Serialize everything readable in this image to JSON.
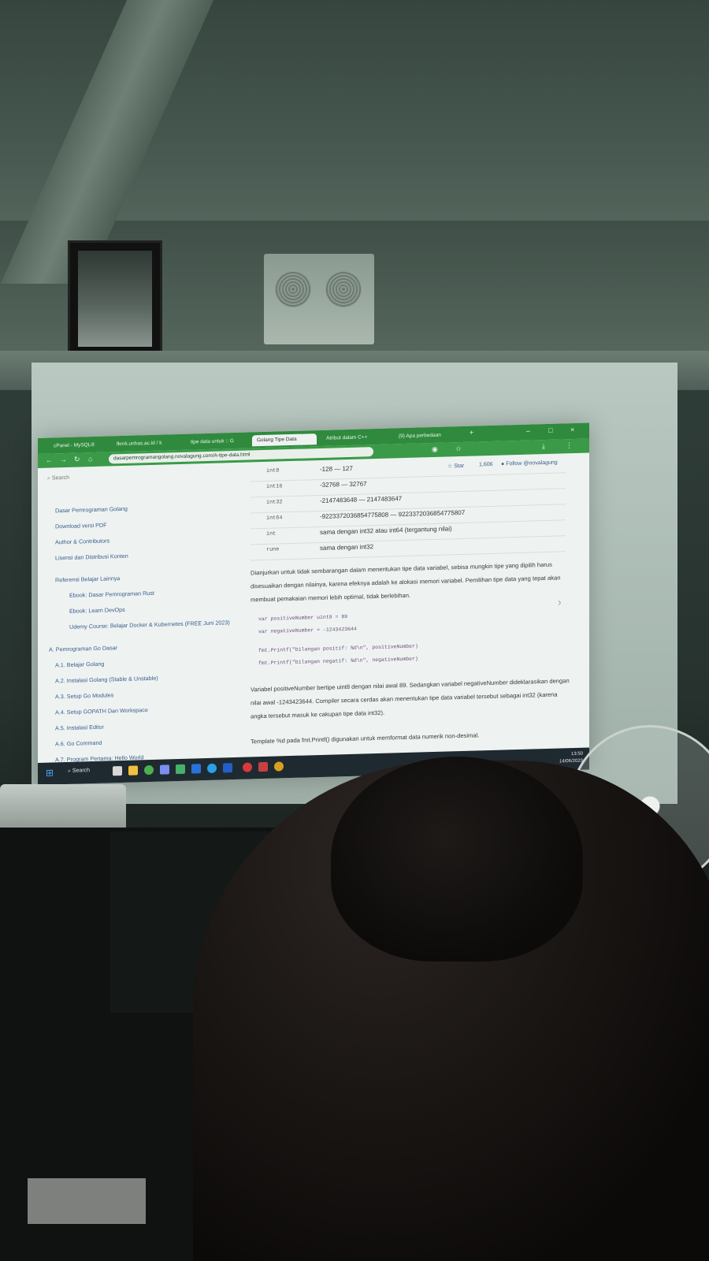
{
  "browser": {
    "tabs": [
      {
        "label": "cPanel - MySQL®"
      },
      {
        "label": "fkmk.unhas.ac.id / k"
      },
      {
        "label": "tipe data untuk :: G"
      },
      {
        "label": "Golang Tipe Data"
      },
      {
        "label": "Atribut dalam C++"
      },
      {
        "label": "(9) Apa perbedaan"
      }
    ],
    "address": "dasarpemrogramangolang.novalagung.com/A-tipe-data.html"
  },
  "sidebar": {
    "search_placeholder": "Search",
    "links": [
      {
        "label": "Dasar Pemrograman Golang"
      },
      {
        "label": "Download versi PDF"
      },
      {
        "label": "Author & Contributors"
      },
      {
        "label": "Lisensi dan Distribusi Konten"
      },
      {
        "label": "Referensi Belajar Lainnya"
      },
      {
        "label": "Ebook: Dasar Pemrograman Rust"
      },
      {
        "label": "Ebook: Learn DevOps"
      },
      {
        "label": "Udemy Course: Belajar Docker & Kubernetes (FREE Juni 2023)"
      },
      {
        "label": "A. Pemrograman Go Dasar"
      },
      {
        "label": "A.1. Belajar Golang"
      },
      {
        "label": "A.2. Instalasi Golang (Stable & Unstable)"
      },
      {
        "label": "A.3. Setup Go Modules"
      },
      {
        "label": "A.4. Setup GOPATH Dan Workspace"
      },
      {
        "label": "A.5. Instalasi Editor"
      },
      {
        "label": "A.6. Go Command"
      },
      {
        "label": "A.7. Program Pertama: Hello World"
      }
    ]
  },
  "topbar": {
    "star": "Star",
    "count": "1,606",
    "follow": "Follow @novalagung"
  },
  "table": [
    {
      "type": "int8",
      "range": "-128 — 127"
    },
    {
      "type": "int16",
      "range": "-32768 — 32767"
    },
    {
      "type": "int32",
      "range": "-2147483648 — 2147483647"
    },
    {
      "type": "int64",
      "range": "-9223372036854775808 — 9223372036854775807"
    },
    {
      "type": "int",
      "range": "sama dengan int32 atau int64 (tergantung nilai)"
    },
    {
      "type": "rune",
      "range": "sama dengan int32"
    }
  ],
  "paragraphs": {
    "p1": "Dianjurkan untuk tidak sembarangan dalam menentukan tipe data variabel, sebisa mungkin tipe yang dipilih harus disesuaikan dengan nilainya, karena efeknya adalah ke alokasi memori variabel. Pemilihan tipe data yang tepat akan membuat pemakaian memori lebih optimal, tidak berlebihan.",
    "p2": "Variabel positiveNumber bertipe uint8 dengan nilai awal 89. Sedangkan variabel negativeNumber dideklarasikan dengan nilai awal -1243423644. Compiler secara cerdas akan menentukan tipe data variabel tersebut sebagai int32 (karena angka tersebut masuk ke cakupan tipe data int32).",
    "p3": "Template %d pada fmt.Printf() digunakan untuk memformat data numerik non-desimal."
  },
  "code": {
    "l1": "var positiveNumber uint8 = 89",
    "l2": "var negativeNumber = -1243423644",
    "l3": "fmt.Printf(\"bilangan positif: %d\\n\", positiveNumber)",
    "l4": "fmt.Printf(\"bilangan negatif: %d\\n\", negativeNumber)"
  },
  "taskbar": {
    "search": "Search",
    "time": "13:50",
    "date": "14/06/2023"
  }
}
